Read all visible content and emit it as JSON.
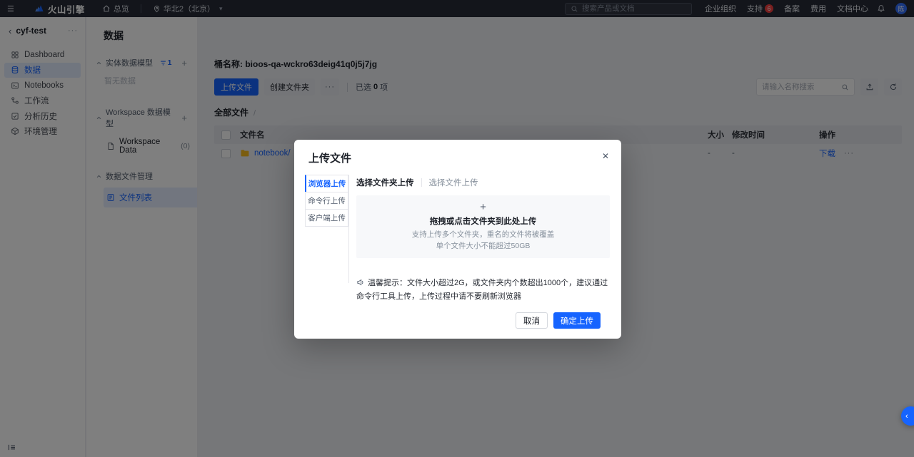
{
  "topbar": {
    "brand": "火山引擎",
    "overview": "总览",
    "region": "华北2（北京）",
    "search_placeholder": "搜索产品或文档",
    "link_org": "企业组织",
    "link_support": "支持",
    "support_badge": "6",
    "link_beian": "备案",
    "link_fee": "费用",
    "link_docs": "文档中心",
    "avatar_text": "陈"
  },
  "sidebar": {
    "workspace_name": "cyf-test",
    "items": [
      {
        "label": "Dashboard"
      },
      {
        "label": "数据"
      },
      {
        "label": "Notebooks"
      },
      {
        "label": "工作流"
      },
      {
        "label": "分析历史"
      },
      {
        "label": "环境管理"
      }
    ]
  },
  "data_panel": {
    "title": "数据",
    "section_entity": "实体数据模型",
    "entity_filter_count": "1",
    "entity_empty": "暂无数据",
    "section_workspace": "Workspace 数据模型",
    "workspace_item": "Workspace Data",
    "workspace_count": "(0)",
    "section_files": "数据文件管理",
    "files_item": "文件列表"
  },
  "content": {
    "bucket_label": "桶名称: bioos-qa-wckro63deig41q0j5j7jg",
    "btn_upload": "上传文件",
    "btn_create_folder": "创建文件夹",
    "selected_prefix": "已选",
    "selected_count": "0",
    "selected_suffix": "项",
    "search_placeholder": "请输入名称搜索",
    "breadcrumb_root": "全部文件",
    "breadcrumb_sep": "/",
    "table": {
      "col_name": "文件名",
      "col_size": "大小",
      "col_modified": "修改时间",
      "col_actions": "操作",
      "rows": [
        {
          "name": "notebook/",
          "size": "-",
          "modified": "-",
          "action": "下载"
        }
      ]
    }
  },
  "modal": {
    "title": "上传文件",
    "side_tabs": [
      {
        "label": "浏览器上传"
      },
      {
        "label": "命令行上传"
      },
      {
        "label": "客户端上传"
      }
    ],
    "tab_folder": "选择文件夹上传",
    "tab_file": "选择文件上传",
    "drop_title": "拖拽或点击文件夹到此处上传",
    "drop_hint1": "支持上传多个文件夹，重名的文件将被覆盖",
    "drop_hint2": "单个文件大小不能超过50GB",
    "tip": "温馨提示：文件大小超过2G，或文件夹内个数超出1000个，建议通过命令行工具上传，上传过程中请不要刷新浏览器",
    "btn_cancel": "取消",
    "btn_confirm": "确定上传"
  },
  "icons": {
    "hamburger": "☰",
    "chevron_down": "▾",
    "back": "‹",
    "more": "···",
    "close": "✕",
    "plus": "+",
    "float_chevron": "‹"
  },
  "colors": {
    "primary": "#1664ff",
    "badge_red": "#f53f3f",
    "folder_yellow": "#f7ba1e",
    "topbar_bg": "#262b36"
  }
}
